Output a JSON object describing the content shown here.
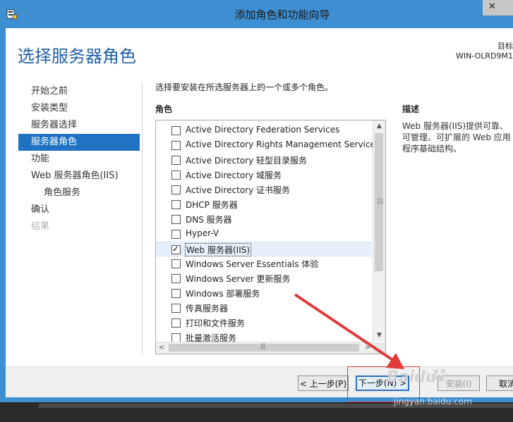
{
  "window": {
    "title": "添加角色和功能向导",
    "close_label": "✕"
  },
  "header": {
    "page_title": "选择服务器角色",
    "target_label": "目标",
    "target_server": "WIN-OLRD9M1"
  },
  "nav": {
    "items": [
      {
        "label": "开始之前"
      },
      {
        "label": "安装类型"
      },
      {
        "label": "服务器选择"
      },
      {
        "label": "服务器角色"
      },
      {
        "label": "功能"
      },
      {
        "label": "Web 服务器角色(IIS)"
      },
      {
        "label": "角色服务"
      },
      {
        "label": "确认"
      },
      {
        "label": "结果"
      }
    ]
  },
  "main": {
    "instruction": "选择要安装在所选服务器上的一个或多个角色。",
    "roles_header": "角色",
    "roles": [
      {
        "label": "Active Directory Federation Services",
        "checked": false
      },
      {
        "label": "Active Directory Rights Management Services",
        "checked": false
      },
      {
        "label": "Active Directory 轻型目录服务",
        "checked": false
      },
      {
        "label": "Active Directory 域服务",
        "checked": false
      },
      {
        "label": "Active Directory 证书服务",
        "checked": false
      },
      {
        "label": "DHCP 服务器",
        "checked": false
      },
      {
        "label": "DNS 服务器",
        "checked": false
      },
      {
        "label": "Hyper-V",
        "checked": false
      },
      {
        "label": "Web 服务器(IIS)",
        "checked": true
      },
      {
        "label": "Windows Server Essentials 体验",
        "checked": false
      },
      {
        "label": "Windows Server 更新服务",
        "checked": false
      },
      {
        "label": "Windows 部署服务",
        "checked": false
      },
      {
        "label": "传真服务器",
        "checked": false
      },
      {
        "label": "打印和文件服务",
        "checked": false
      },
      {
        "label": "批量激活服务",
        "checked": false
      }
    ],
    "description_header": "描述",
    "description_text": "Web 服务器(IIS)提供可靠、可管理、可扩展的 Web 应用程序基础结构。"
  },
  "footer": {
    "prev_label": "< 上一步(P)",
    "next_label": "下一步(N) >",
    "install_label": "安装(I)",
    "cancel_label": "取消"
  },
  "watermark": {
    "main": "Baidu",
    "sub": "jingyan.baidu.com"
  },
  "colors": {
    "title_bar": "#3e8fd1",
    "accent": "#1f73c2",
    "annotation": "#e03a3a"
  }
}
